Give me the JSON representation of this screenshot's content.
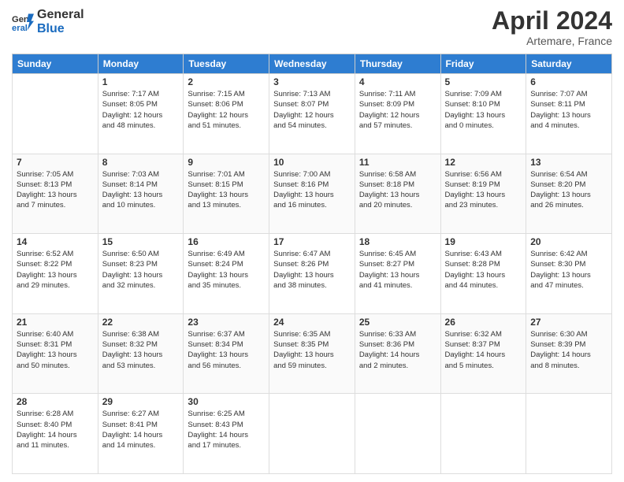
{
  "header": {
    "logo_line1": "General",
    "logo_line2": "Blue",
    "month_title": "April 2024",
    "location": "Artemare, France"
  },
  "days_of_week": [
    "Sunday",
    "Monday",
    "Tuesday",
    "Wednesday",
    "Thursday",
    "Friday",
    "Saturday"
  ],
  "weeks": [
    [
      {
        "num": "",
        "info": ""
      },
      {
        "num": "1",
        "info": "Sunrise: 7:17 AM\nSunset: 8:05 PM\nDaylight: 12 hours\nand 48 minutes."
      },
      {
        "num": "2",
        "info": "Sunrise: 7:15 AM\nSunset: 8:06 PM\nDaylight: 12 hours\nand 51 minutes."
      },
      {
        "num": "3",
        "info": "Sunrise: 7:13 AM\nSunset: 8:07 PM\nDaylight: 12 hours\nand 54 minutes."
      },
      {
        "num": "4",
        "info": "Sunrise: 7:11 AM\nSunset: 8:09 PM\nDaylight: 12 hours\nand 57 minutes."
      },
      {
        "num": "5",
        "info": "Sunrise: 7:09 AM\nSunset: 8:10 PM\nDaylight: 13 hours\nand 0 minutes."
      },
      {
        "num": "6",
        "info": "Sunrise: 7:07 AM\nSunset: 8:11 PM\nDaylight: 13 hours\nand 4 minutes."
      }
    ],
    [
      {
        "num": "7",
        "info": "Sunrise: 7:05 AM\nSunset: 8:13 PM\nDaylight: 13 hours\nand 7 minutes."
      },
      {
        "num": "8",
        "info": "Sunrise: 7:03 AM\nSunset: 8:14 PM\nDaylight: 13 hours\nand 10 minutes."
      },
      {
        "num": "9",
        "info": "Sunrise: 7:01 AM\nSunset: 8:15 PM\nDaylight: 13 hours\nand 13 minutes."
      },
      {
        "num": "10",
        "info": "Sunrise: 7:00 AM\nSunset: 8:16 PM\nDaylight: 13 hours\nand 16 minutes."
      },
      {
        "num": "11",
        "info": "Sunrise: 6:58 AM\nSunset: 8:18 PM\nDaylight: 13 hours\nand 20 minutes."
      },
      {
        "num": "12",
        "info": "Sunrise: 6:56 AM\nSunset: 8:19 PM\nDaylight: 13 hours\nand 23 minutes."
      },
      {
        "num": "13",
        "info": "Sunrise: 6:54 AM\nSunset: 8:20 PM\nDaylight: 13 hours\nand 26 minutes."
      }
    ],
    [
      {
        "num": "14",
        "info": "Sunrise: 6:52 AM\nSunset: 8:22 PM\nDaylight: 13 hours\nand 29 minutes."
      },
      {
        "num": "15",
        "info": "Sunrise: 6:50 AM\nSunset: 8:23 PM\nDaylight: 13 hours\nand 32 minutes."
      },
      {
        "num": "16",
        "info": "Sunrise: 6:49 AM\nSunset: 8:24 PM\nDaylight: 13 hours\nand 35 minutes."
      },
      {
        "num": "17",
        "info": "Sunrise: 6:47 AM\nSunset: 8:26 PM\nDaylight: 13 hours\nand 38 minutes."
      },
      {
        "num": "18",
        "info": "Sunrise: 6:45 AM\nSunset: 8:27 PM\nDaylight: 13 hours\nand 41 minutes."
      },
      {
        "num": "19",
        "info": "Sunrise: 6:43 AM\nSunset: 8:28 PM\nDaylight: 13 hours\nand 44 minutes."
      },
      {
        "num": "20",
        "info": "Sunrise: 6:42 AM\nSunset: 8:30 PM\nDaylight: 13 hours\nand 47 minutes."
      }
    ],
    [
      {
        "num": "21",
        "info": "Sunrise: 6:40 AM\nSunset: 8:31 PM\nDaylight: 13 hours\nand 50 minutes."
      },
      {
        "num": "22",
        "info": "Sunrise: 6:38 AM\nSunset: 8:32 PM\nDaylight: 13 hours\nand 53 minutes."
      },
      {
        "num": "23",
        "info": "Sunrise: 6:37 AM\nSunset: 8:34 PM\nDaylight: 13 hours\nand 56 minutes."
      },
      {
        "num": "24",
        "info": "Sunrise: 6:35 AM\nSunset: 8:35 PM\nDaylight: 13 hours\nand 59 minutes."
      },
      {
        "num": "25",
        "info": "Sunrise: 6:33 AM\nSunset: 8:36 PM\nDaylight: 14 hours\nand 2 minutes."
      },
      {
        "num": "26",
        "info": "Sunrise: 6:32 AM\nSunset: 8:37 PM\nDaylight: 14 hours\nand 5 minutes."
      },
      {
        "num": "27",
        "info": "Sunrise: 6:30 AM\nSunset: 8:39 PM\nDaylight: 14 hours\nand 8 minutes."
      }
    ],
    [
      {
        "num": "28",
        "info": "Sunrise: 6:28 AM\nSunset: 8:40 PM\nDaylight: 14 hours\nand 11 minutes."
      },
      {
        "num": "29",
        "info": "Sunrise: 6:27 AM\nSunset: 8:41 PM\nDaylight: 14 hours\nand 14 minutes."
      },
      {
        "num": "30",
        "info": "Sunrise: 6:25 AM\nSunset: 8:43 PM\nDaylight: 14 hours\nand 17 minutes."
      },
      {
        "num": "",
        "info": ""
      },
      {
        "num": "",
        "info": ""
      },
      {
        "num": "",
        "info": ""
      },
      {
        "num": "",
        "info": ""
      }
    ]
  ]
}
